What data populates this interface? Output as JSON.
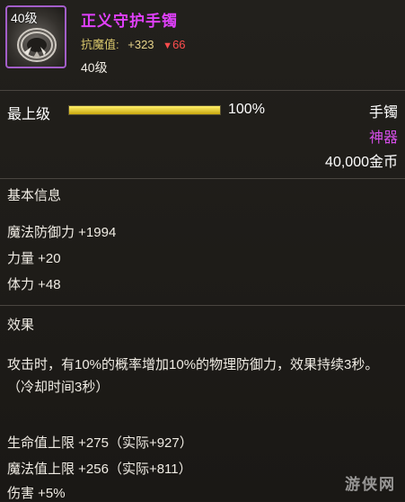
{
  "item": {
    "level_badge": "40级",
    "name": "正义守护手镯",
    "resist_label": "抗魔值:",
    "resist_up": "+323",
    "resist_down_glyph": "▼",
    "resist_down": "66",
    "required_level": "40级",
    "icon": "bracelet-icon"
  },
  "grade": {
    "label": "最上级",
    "percent_text": "100%",
    "progress": 1.0
  },
  "meta": {
    "type": "手镯",
    "rarity": "神器",
    "price": "40,000金币"
  },
  "basic": {
    "title": "基本信息",
    "stats": [
      "魔法防御力 +1994",
      "力量 +20",
      "体力 +48"
    ]
  },
  "effect": {
    "title": "效果",
    "description": "攻击时，有10%的概率增加10%的物理防御力，效果持续3秒。（冷却时间3秒）",
    "stats": [
      "生命值上限 +275（实际+927）",
      "魔法值上限 +256（实际+811）",
      "伤害 +5%"
    ]
  },
  "watermark": "游侠网",
  "colors": {
    "name": "#e040fb",
    "rarity": "#d64ee8",
    "icon_border": "#a35ec9",
    "resist_down": "#ff4d4d",
    "grade_fill": "#e6c91e"
  }
}
